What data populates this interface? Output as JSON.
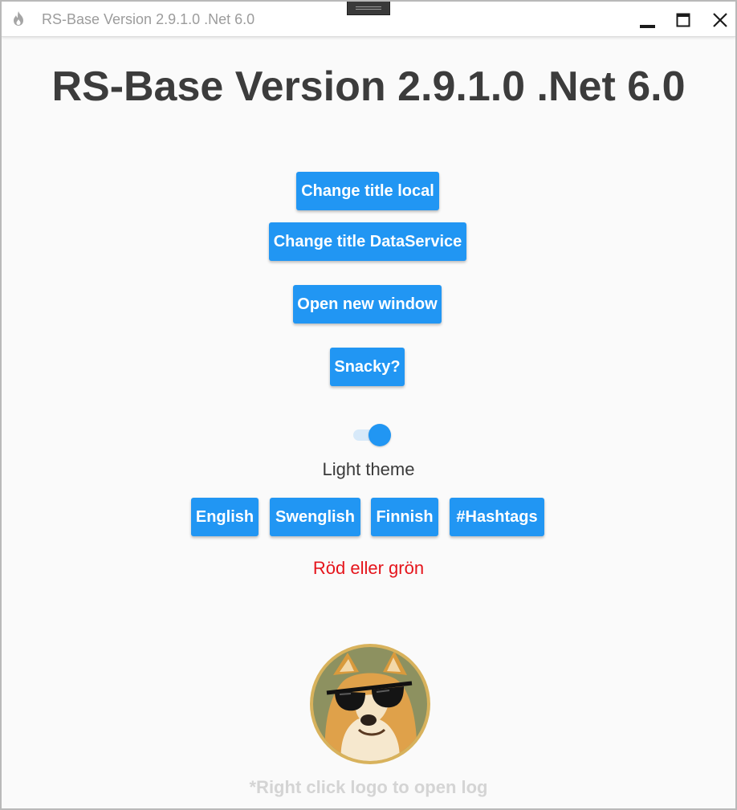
{
  "window": {
    "title": "RS-Base Version 2.9.1.0 .Net 6.0",
    "app_icon": "flame-icon",
    "controls": [
      "minimize-icon",
      "maximize-icon",
      "close-icon"
    ]
  },
  "main": {
    "heading": "RS-Base Version 2.9.1.0 .Net 6.0",
    "buttons": {
      "change_title_local": "Change title local",
      "change_title_dataservice": "Change title DataService",
      "open_new_window": "Open new window",
      "snacky": "Snacky?"
    },
    "theme_toggle": {
      "checked": true,
      "label": "Light theme"
    },
    "language_buttons": [
      "English",
      "Swenglish",
      "Finnish",
      "#Hashtags"
    ],
    "color_text": "Röd eller grön",
    "logo": "doge-sunglasses-logo",
    "hint": "*Right click logo to open log"
  },
  "colors": {
    "accent": "#2196f3",
    "heading": "#3c3c3c",
    "red_text": "#e5141b",
    "hint": "#d4d4d4",
    "background": "#fafafa"
  }
}
